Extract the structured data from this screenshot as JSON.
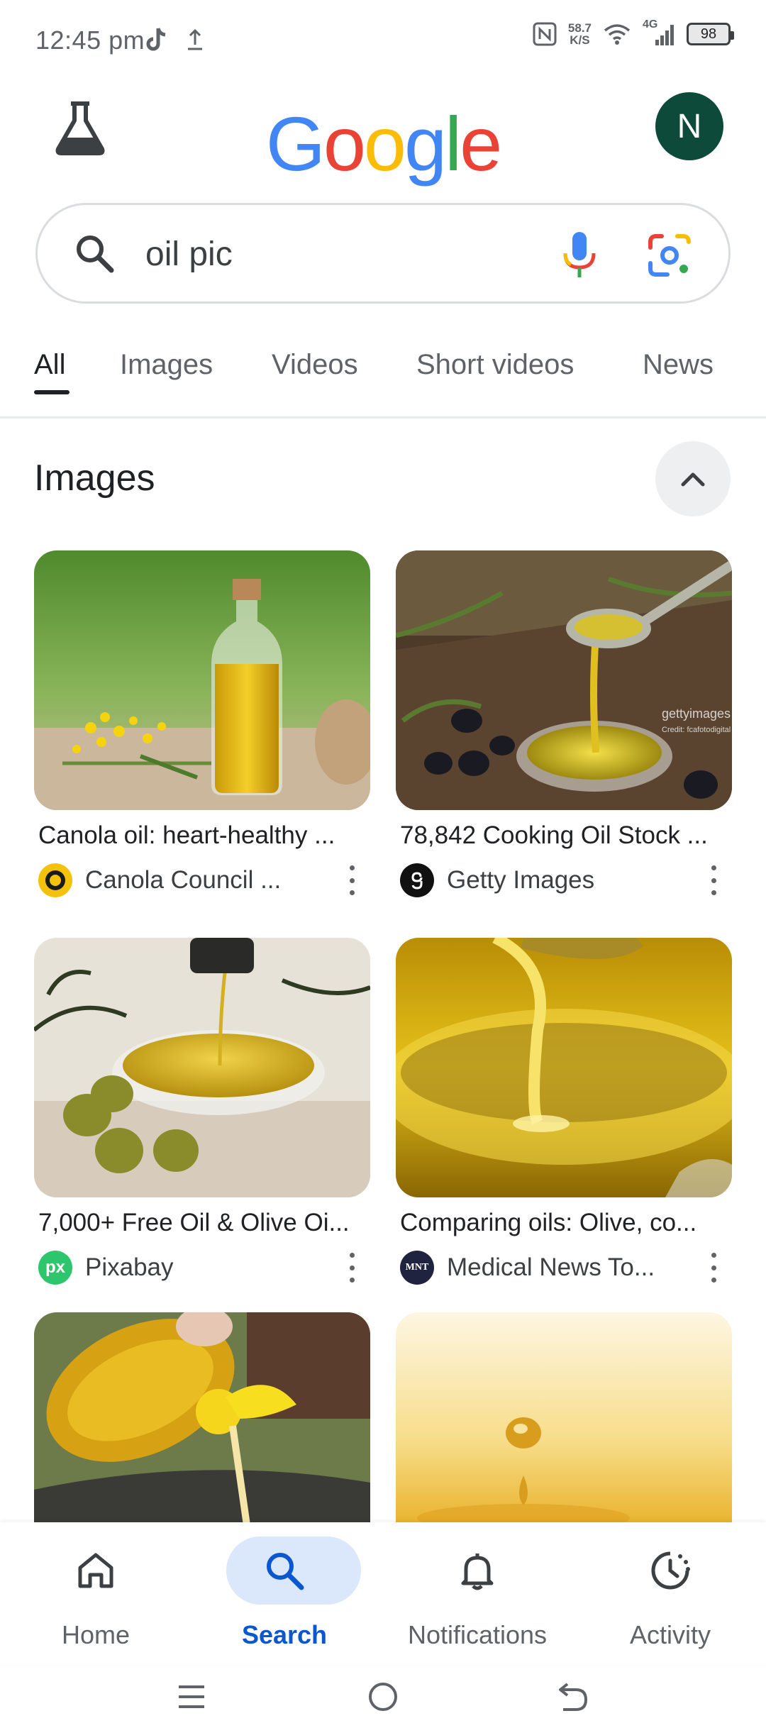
{
  "status_bar": {
    "time": "12:45 pm",
    "net_speed_value": "58.7",
    "net_speed_unit": "K/S",
    "network": "4G",
    "battery": "98"
  },
  "header": {
    "logo_letters": [
      "G",
      "o",
      "o",
      "g",
      "l",
      "e"
    ],
    "logo_colors": [
      "#4285F4",
      "#EA4335",
      "#FBBC05",
      "#4285F4",
      "#34A853",
      "#EA4335"
    ],
    "avatar_initial": "N"
  },
  "search": {
    "query": "oil pic"
  },
  "tabs": [
    {
      "label": "All",
      "active": true
    },
    {
      "label": "Images",
      "active": false
    },
    {
      "label": "Videos",
      "active": false
    },
    {
      "label": "Short videos",
      "active": false
    },
    {
      "label": "News",
      "active": false
    }
  ],
  "images_section": {
    "title": "Images",
    "results": [
      {
        "title": "Canola oil: heart-healthy ...",
        "source": "Canola Council ...",
        "icon": "canola-council-icon"
      },
      {
        "title": "78,842 Cooking Oil Stock ...",
        "source": "Getty Images",
        "icon": "getty-images-icon",
        "watermark": "gettyimages",
        "watermark_credit": "Credit: fcafotodigital"
      },
      {
        "title": "7,000+ Free Oil & Olive Oi...",
        "source": "Pixabay",
        "icon": "pixabay-icon",
        "icon_text": "px"
      },
      {
        "title": "Comparing oils: Olive, co...",
        "source": "Medical News To...",
        "icon": "medical-news-today-icon",
        "icon_text": "MNT"
      },
      {
        "title": "",
        "source": "",
        "icon": ""
      },
      {
        "title": "",
        "source": "",
        "icon": ""
      }
    ]
  },
  "bottom_nav": [
    {
      "label": "Home",
      "icon": "home-icon",
      "active": false
    },
    {
      "label": "Search",
      "icon": "search-icon",
      "active": true
    },
    {
      "label": "Notifications",
      "icon": "bell-icon",
      "active": false
    },
    {
      "label": "Activity",
      "icon": "activity-icon",
      "active": false
    }
  ],
  "colors": {
    "accent": "#0b57d0",
    "active_pill": "#dbe7fb",
    "avatar_bg": "#0d4a3a"
  }
}
